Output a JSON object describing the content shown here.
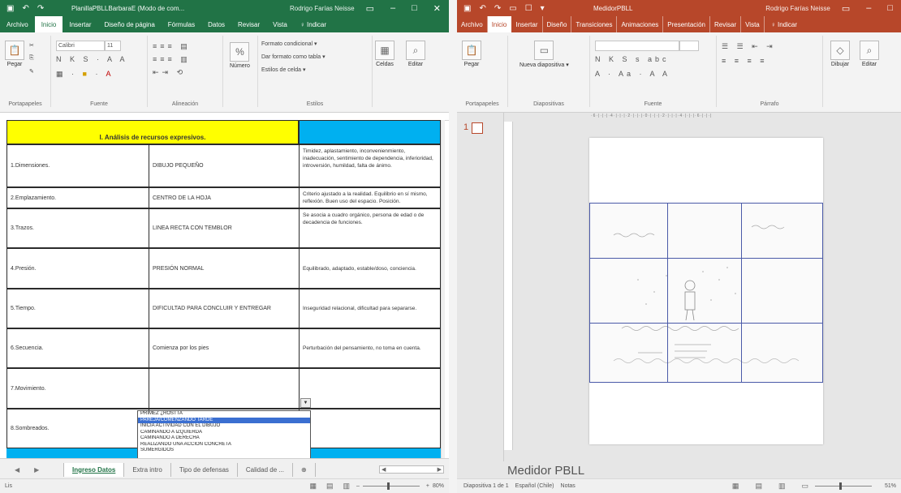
{
  "excel": {
    "title": "PlanillaPBLLBarbaraE (Modo de com...",
    "user": "Rodrigo Farías Neisse",
    "accent": "#217346",
    "tabs": [
      "Archivo",
      "Inicio",
      "Insertar",
      "Diseño de página",
      "Fórmulas",
      "Datos",
      "Revisar",
      "Vista",
      "♀ Indicar"
    ],
    "active_tab": "Inicio",
    "ribbon": {
      "paste": "Pegar",
      "font_name": "Calibri",
      "font_size": "11",
      "number_label": "Número",
      "cond_format": "Formato condicional ▾",
      "table_format": "Dar formato como tabla ▾",
      "cell_styles": "Estilos de celda ▾",
      "cells": "Celdas",
      "edit": "Editar",
      "groups": [
        "Portapapeles",
        "Fuente",
        "Alineación",
        "Estilos"
      ]
    },
    "sheet": {
      "header": "I. Análisis de recursos expresivos.",
      "rows": [
        {
          "label": "1.Dimensiones.",
          "value": "DIBUJO PEQUEÑO",
          "desc": "Timidez, aplastamiento, inconvenienmiento, inadecuación, sentimiento de dependencia, inferioridad, introversión, humildad, falta de ánimo."
        },
        {
          "label": "2.Emplazamiento.",
          "value": "CENTRO DE LA HOJA",
          "desc": "Criterio ajustado a la realidad. Equilibrio en sí mismo, reflexión. Buen uso del espacio. Posición."
        },
        {
          "label": "3.Trazos.",
          "value": "LINEA RECTA CON TEMBLOR",
          "desc": "Se asocia a cuadro orgánico, persona de edad o de decadencia de funciones."
        },
        {
          "label": "4.Presión.",
          "value": "PRESIÓN NORMAL",
          "desc": "Equilibrado, adaptado, estable/doso, conciencia."
        },
        {
          "label": "5.Tiempo.",
          "value": "DIFICULTAD PARA CONCLUIR Y ENTREGAR",
          "desc": "Inseguridad relacional, dificultad para separarse."
        },
        {
          "label": "6.Secuencia.",
          "value": "Comienza por los pies",
          "desc": "Perturbación del pensamiento, no toma en cuenta."
        },
        {
          "label": "7.Movimiento.",
          "value": "",
          "desc": ""
        },
        {
          "label": "8.Sombreados.",
          "value": "",
          "desc": ""
        }
      ],
      "dropdown_options": [
        "PRIMEZ ¿ROSTTA",
        "PAREJA/COMENZANDO TARDE",
        "INICIA ACTIVIDAD CON EL DIBUJO",
        "CAMINANDO A IZQUIERDA",
        "CAMINANDO A DERECHA",
        "REALIZANDO UNA ACCIÓN CONCRETA",
        "SUMERGIDOS"
      ],
      "selected_option_index": 1
    },
    "sheet_tabs": [
      "Ingreso Datos",
      "Extra intro",
      "Tipo de defensas",
      "Calidad de ..."
    ],
    "active_sheet": "Ingreso Datos",
    "status": {
      "left": "Lis",
      "zoom": "80%"
    }
  },
  "ppt": {
    "title": "MedidorPBLL",
    "user": "Rodrigo Farías Neisse",
    "accent": "#b7472a",
    "tabs": [
      "Archivo",
      "Inicio",
      "Insertar",
      "Diseño",
      "Transiciones",
      "Animaciones",
      "Presentación",
      "Revisar",
      "Vista",
      "♀ Indicar"
    ],
    "active_tab": "Inicio",
    "ribbon": {
      "paste": "Pegar",
      "new_slide": "Nueva diapositiva ▾",
      "draw": "Dibujar",
      "edit": "Editar",
      "groups": [
        "Portapapeles",
        "Diapositivas",
        "Fuente",
        "Párrafo"
      ]
    },
    "slide_number": "1",
    "notes_title": "Medidor PBLL",
    "status": {
      "slide": "Diapositiva 1 de 1",
      "language": "Español (Chile)",
      "notes": "Notas",
      "zoom": "51%"
    }
  }
}
